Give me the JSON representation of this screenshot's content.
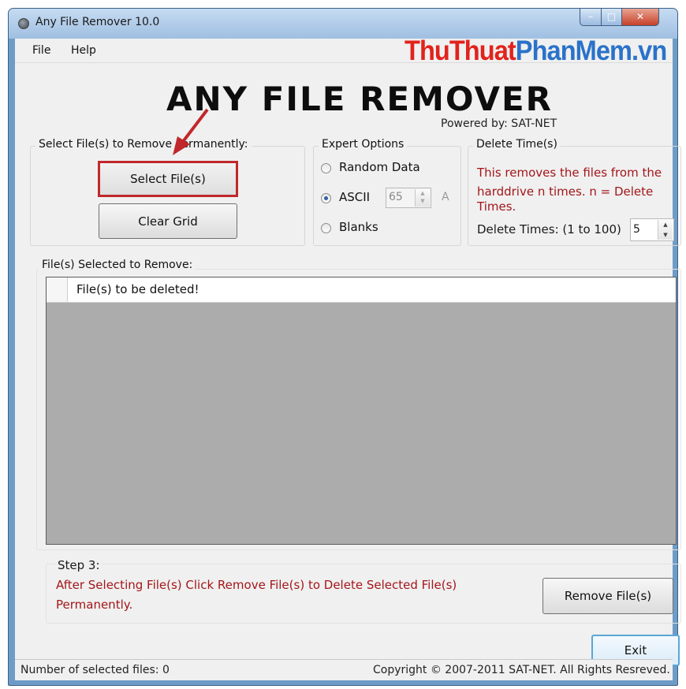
{
  "window": {
    "title": "Any File Remover 10.0",
    "controls": {
      "minimize": "–",
      "maximize": "□",
      "close": "✕"
    }
  },
  "menu": {
    "items": [
      "File",
      "Help"
    ]
  },
  "watermark": {
    "part1": "ThuThuat",
    "part2": "PhanMem.vn"
  },
  "logo": {
    "text": "ANY FILE REMOVER",
    "powered_by": "Powered by: SAT-NET"
  },
  "select_group": {
    "title": "Select File(s) to Remove Permanently:",
    "select_button": "Select File(s)",
    "clear_button": "Clear Grid"
  },
  "expert_options": {
    "title": "Expert Options",
    "options": [
      {
        "label": "Random Data",
        "checked": false
      },
      {
        "label": "ASCII",
        "checked": true
      },
      {
        "label": "Blanks",
        "checked": false
      }
    ],
    "ascii_value": "65",
    "ascii_char": "A"
  },
  "delete_time": {
    "title": "Delete Time(s)",
    "description_line1": "This removes the files from the",
    "description_line2": "harddrive n times. n = Delete",
    "description_line3": "Times.",
    "times_label": "Delete Times: (1 to 100)",
    "times_value": "5"
  },
  "files_group": {
    "title": "File(s) Selected to Remove:",
    "column_header": "File(s) to be deleted!",
    "rows": []
  },
  "step3": {
    "title": "Step 3:",
    "instruction_line1": "After Selecting File(s) Click Remove File(s) to Delete Selected File(s)",
    "instruction_line2": "Permanently.",
    "remove_button": "Remove File(s)"
  },
  "exit_button": "Exit",
  "status": {
    "selected_count_label": "Number of selected files:",
    "selected_count": "0",
    "copyright": "Copyright © 2007-2011 SAT-NET. All Rights Resreved."
  },
  "colors": {
    "accent_red": "#a3161a",
    "highlight_border": "#c0282b",
    "watermark_red": "#e2221c",
    "watermark_blue": "#2a72c9"
  }
}
